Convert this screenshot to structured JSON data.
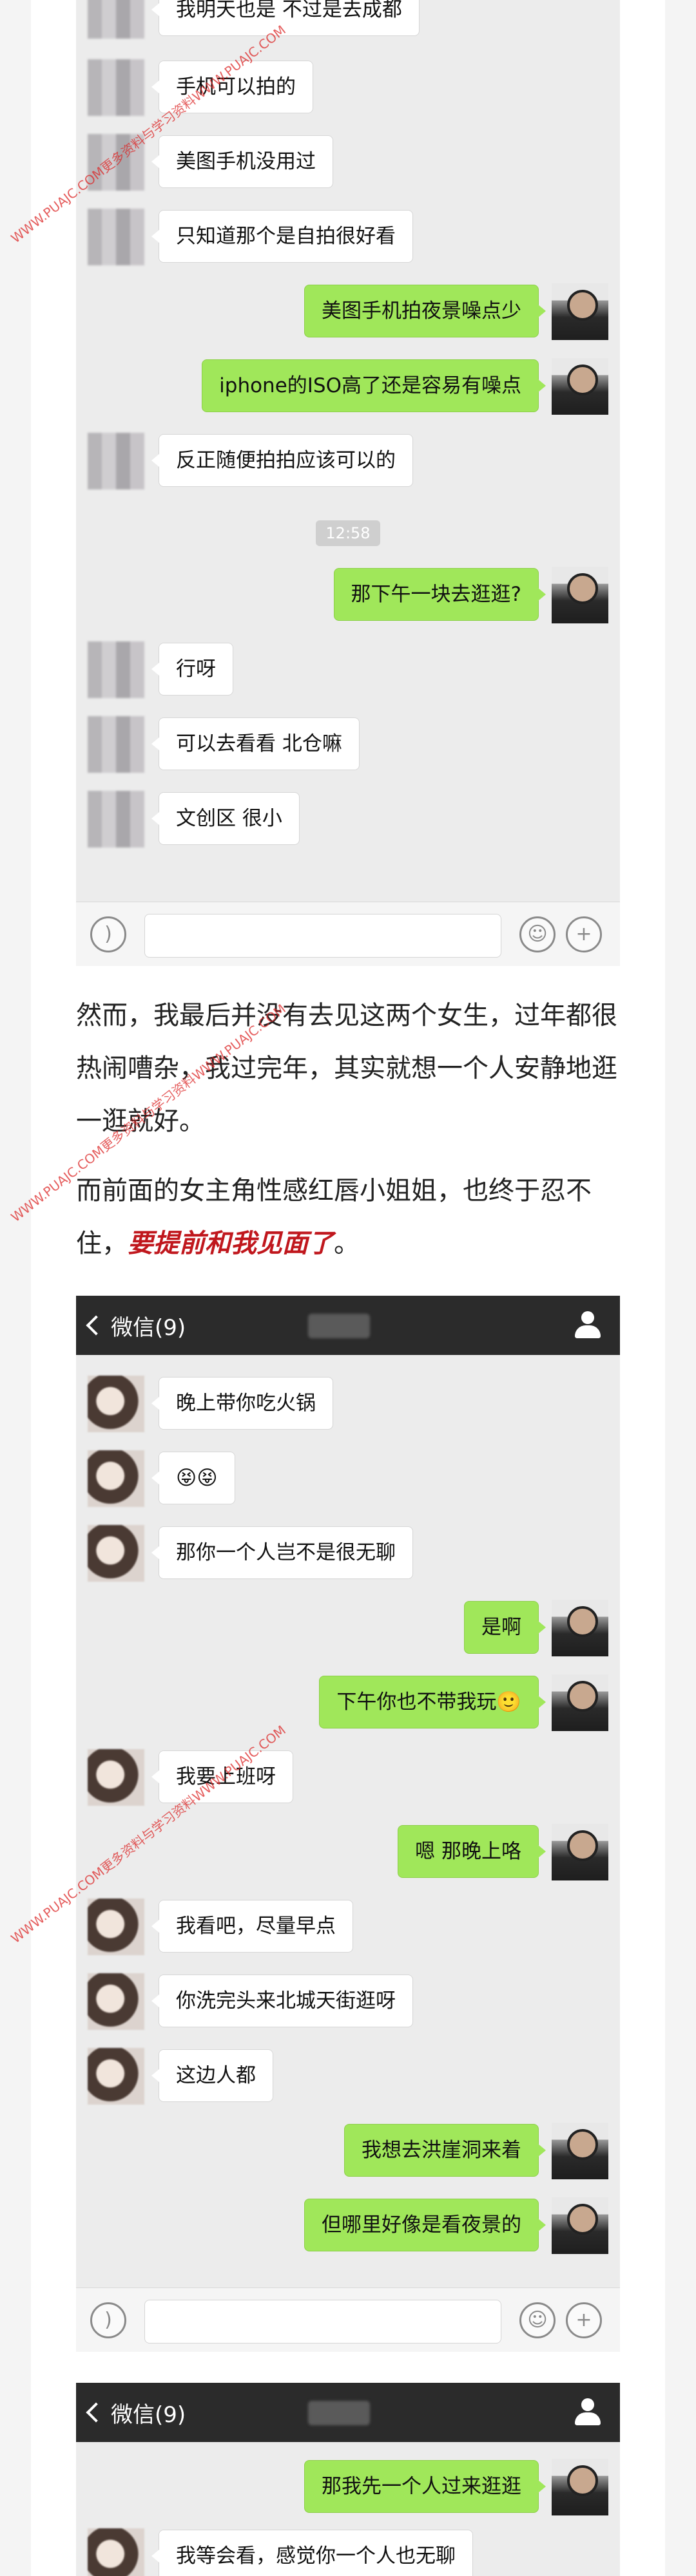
{
  "chat1": {
    "messages": [
      {
        "side": "left",
        "avatar": "blur",
        "text": "我明天也是 不过是去成都"
      },
      {
        "side": "left",
        "avatar": "blur",
        "text": "手机可以拍的"
      },
      {
        "side": "left",
        "avatar": "blur",
        "text": "美图手机没用过"
      },
      {
        "side": "left",
        "avatar": "blur",
        "text": "只知道那个是自拍很好看"
      },
      {
        "side": "right",
        "avatar": "me",
        "text": "美图手机拍夜景噪点少"
      },
      {
        "side": "right",
        "avatar": "me",
        "text": "iphone的ISO高了还是容易有噪点"
      },
      {
        "side": "left",
        "avatar": "blur",
        "text": "反正随便拍拍应该可以的"
      },
      {
        "side": "right",
        "avatar": "me",
        "text": "那下午一块去逛逛?"
      },
      {
        "side": "left",
        "avatar": "blur",
        "text": "行呀"
      },
      {
        "side": "left",
        "avatar": "blur",
        "text": "可以去看看 北仓嘛"
      },
      {
        "side": "left",
        "avatar": "blur",
        "text": "文创区 很小"
      }
    ],
    "timestamp": "12:58"
  },
  "article": {
    "para1": "然而，我最后并没有去见这两个女生，过年都很热闹嘈杂，我过完年，其实就想一个人安静地逛一逛就好。",
    "para2_prefix": "而前面的女主角性感红唇小姐姐，也终于忍不住，",
    "para2_emphasis": "要提前和我见面了",
    "para2_suffix": "。"
  },
  "chat2": {
    "back_label": "微信(9)",
    "messages": [
      {
        "side": "left",
        "avatar": "girl",
        "text": "晚上带你吃火锅"
      },
      {
        "side": "left",
        "avatar": "girl",
        "text": "😝😝"
      },
      {
        "side": "left",
        "avatar": "girl",
        "text": "那你一个人岂不是很无聊"
      },
      {
        "side": "right",
        "avatar": "me",
        "text": "是啊"
      },
      {
        "side": "right",
        "avatar": "me",
        "text": "下午你也不带我玩🙂"
      },
      {
        "side": "left",
        "avatar": "girl",
        "text": "我要上班呀"
      },
      {
        "side": "right",
        "avatar": "me",
        "text": "嗯 那晚上咯"
      },
      {
        "side": "left",
        "avatar": "girl",
        "text": "我看吧，尽量早点"
      },
      {
        "side": "left",
        "avatar": "girl",
        "text": "你洗完头来北城天街逛呀"
      },
      {
        "side": "left",
        "avatar": "girl",
        "text": "这边人都"
      },
      {
        "side": "right",
        "avatar": "me",
        "text": "我想去洪崖洞来着"
      },
      {
        "side": "right",
        "avatar": "me",
        "text": "但哪里好像是看夜景的"
      }
    ]
  },
  "chat3": {
    "back_label": "微信(9)",
    "messages": [
      {
        "side": "right",
        "avatar": "me",
        "text": "那我先一个人过来逛逛"
      },
      {
        "side": "left",
        "avatar": "girl",
        "text": "我等会看，感觉你一个人也无聊"
      }
    ]
  },
  "watermark": "WWW.PUAJC.COM更多资料与学习资料WWW.PUAJC.COM",
  "colors": {
    "my_bubble": "#a0e75a",
    "their_bubble": "#ffffff",
    "chat_bg": "#ececec",
    "titlebar": "#2b2b2b",
    "emphasis": "#c0171d"
  }
}
